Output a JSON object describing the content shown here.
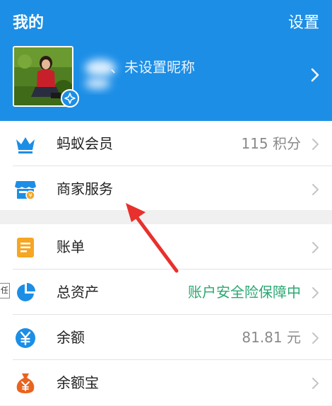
{
  "header": {
    "title": "我的",
    "settings_label": "设置",
    "nickname": "、未设置昵称"
  },
  "section1": {
    "items": [
      {
        "label": "蚂蚁会员",
        "value": "115 积分",
        "icon": "crown-icon"
      },
      {
        "label": "商家服务",
        "value": "",
        "icon": "merchant-store-icon"
      }
    ]
  },
  "section2": {
    "items": [
      {
        "label": "账单",
        "value": "",
        "icon": "bill-icon"
      },
      {
        "label": "总资产",
        "value": "账户安全险保障中",
        "icon": "pie-chart-icon"
      },
      {
        "label": "余额",
        "value": "81.81 元",
        "icon": "yuan-coin-icon"
      },
      {
        "label": "余额宝",
        "value": "",
        "icon": "money-bag-icon"
      }
    ]
  },
  "edge_tag": "任",
  "colors": {
    "header_bg": "#1c8ee6",
    "accent_blue": "#1c8ee6",
    "orange": "#f5a623",
    "green_text": "#2aa872",
    "annotation_red": "#e8302c"
  }
}
